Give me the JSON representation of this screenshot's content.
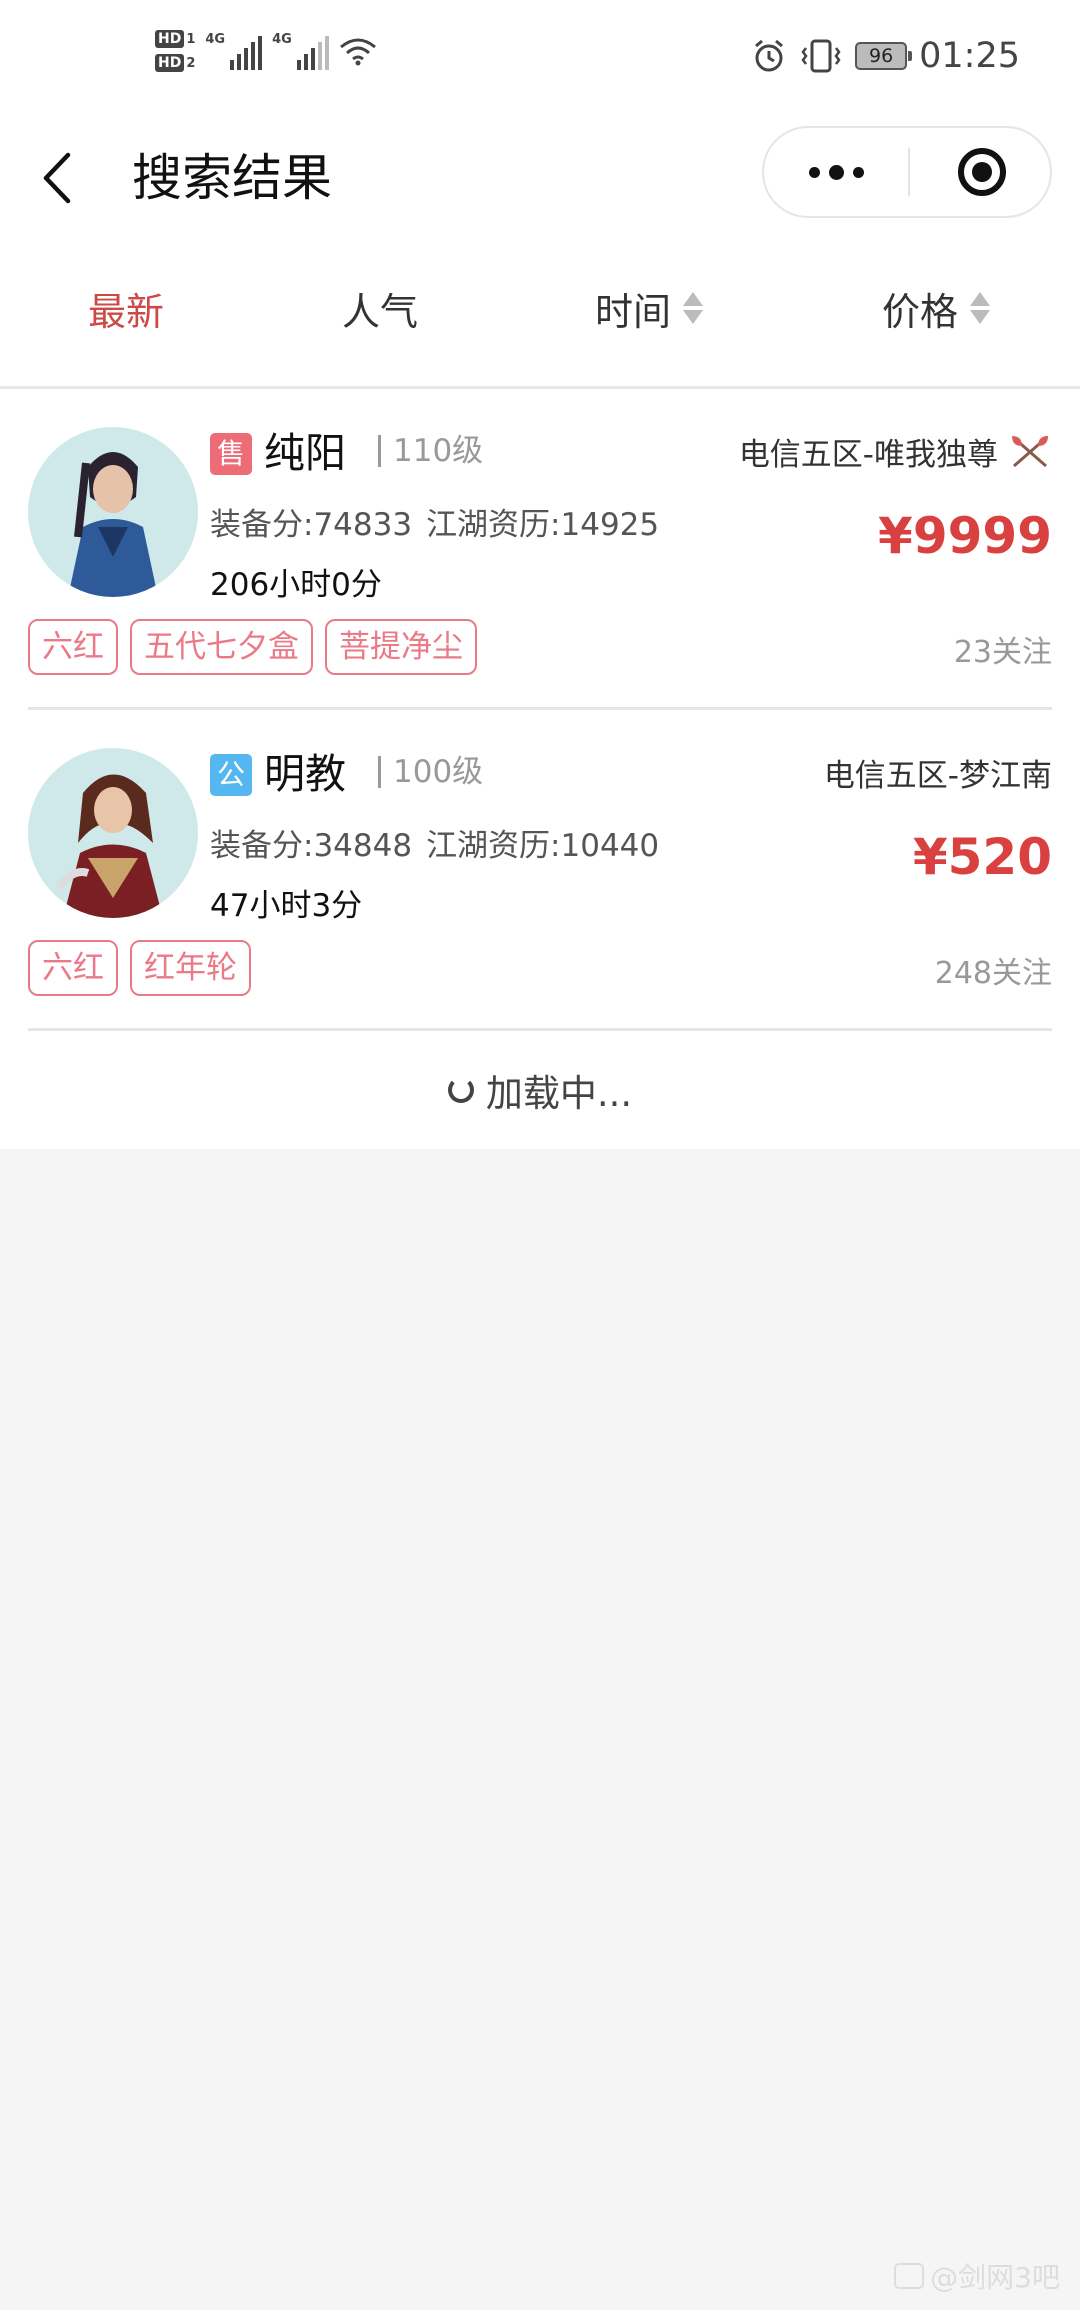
{
  "status_bar": {
    "hd1": "HD",
    "hd1_sub": "1",
    "hd2": "HD",
    "hd2_sub": "2",
    "net1": "4G",
    "net2": "4G",
    "battery": "96",
    "time": "01:25"
  },
  "nav": {
    "title": "搜索结果"
  },
  "sort_tabs": [
    {
      "label": "最新",
      "active": true
    },
    {
      "label": "人气",
      "active": false
    },
    {
      "label": "时间",
      "active": false
    },
    {
      "label": "价格",
      "active": false
    }
  ],
  "results": [
    {
      "badge": "售",
      "school": "纯阳",
      "level": "110级",
      "server": "电信五区-唯我独尊",
      "stats_score": "装备分:74833",
      "stats_exp": "江湖资历:14925",
      "duration": "206小时0分",
      "price": "¥9999",
      "tags": [
        "六红",
        "五代七夕盒",
        "菩提净尘"
      ],
      "follows": "23关注"
    },
    {
      "badge": "公",
      "school": "明教",
      "level": "100级",
      "server": "电信五区-梦江南",
      "stats_score": "装备分:34848",
      "stats_exp": "江湖资历:10440",
      "duration": "47小时3分",
      "price": "¥520",
      "tags": [
        "六红",
        "红年轮"
      ],
      "follows": "248关注"
    }
  ],
  "loading_text": "加载中...",
  "watermark": "@剑网3吧",
  "colors": {
    "accent": "#cc4a46",
    "price": "#d8413f",
    "tag": "#e97a86",
    "badge_sell": "#ee6c78",
    "badge_public": "#55b7ef"
  }
}
